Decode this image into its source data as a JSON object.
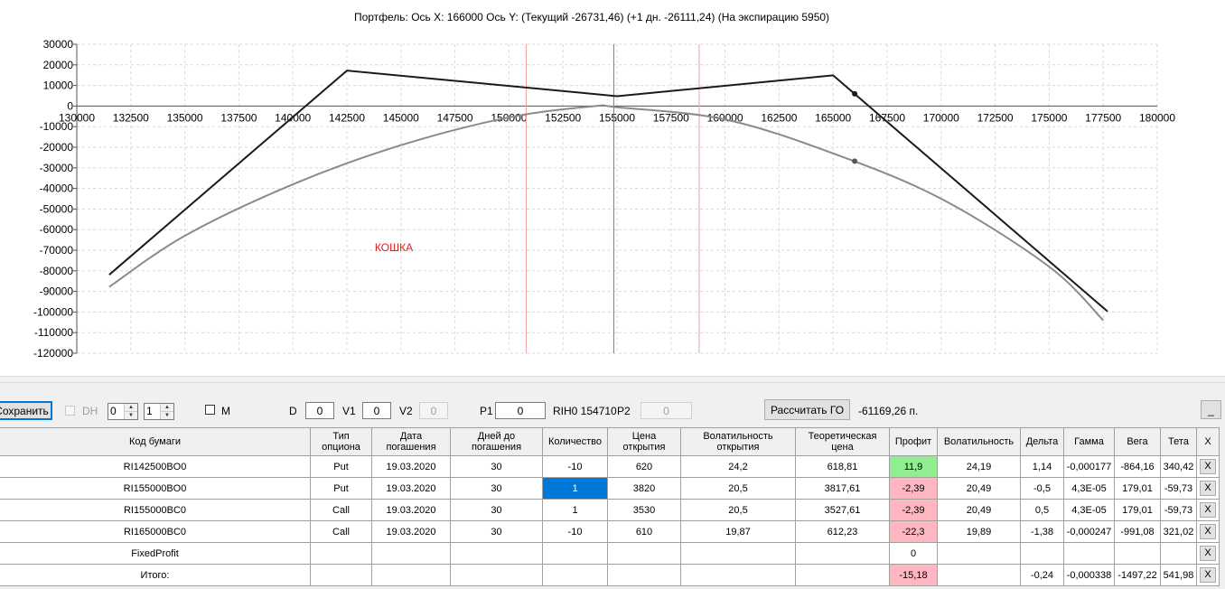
{
  "chart": {
    "title": "Портфель: Ось X: 166000 Ось Y:  (Текущий -26731,46)  (+1 дн. -26111,24)  (На экспирацию 5950)",
    "annotation": "КОШКА"
  },
  "chart_data": {
    "type": "line",
    "title": "Портфель: Ось X: 166000 Ось Y:  (Текущий -26731,46)  (+1 дн. -26111,24)  (На экспирацию 5950)",
    "xlim": [
      130000,
      180000
    ],
    "ylim": [
      -120000,
      30000
    ],
    "x_ticks": [
      "130000",
      "132500",
      "135000",
      "137500",
      "140000",
      "142500",
      "145000",
      "147500",
      "150000",
      "152500",
      "155000",
      "157500",
      "160000",
      "162500",
      "165000",
      "167500",
      "170000",
      "172500",
      "175000",
      "177500",
      "180000"
    ],
    "y_ticks": [
      "30000",
      "20000",
      "10000",
      "0",
      "-10000",
      "-20000",
      "-30000",
      "-40000",
      "-50000",
      "-60000",
      "-70000",
      "-80000",
      "-90000",
      "-100000",
      "-110000",
      "-120000"
    ],
    "grid": true,
    "colors": {
      "expiration": "#1a1a1a",
      "current": "#8a8a8a",
      "vline_center": "#6a7f99",
      "vline_sigma": "#f2a0a0",
      "annotation": "#dd2020"
    },
    "series": [
      {
        "x": [
          131500,
          142500,
          155000,
          165000,
          177700
        ],
        "y": [
          -81900,
          17200,
          4800,
          14900,
          -99700
        ]
      },
      {
        "x": [
          131500,
          135000,
          140000,
          145000,
          150000,
          153900,
          155000,
          160000,
          165000,
          170000,
          175000,
          177500
        ],
        "y": [
          -87800,
          -63000,
          -38000,
          -19000,
          -5500,
          -100,
          -600,
          -6500,
          -23000,
          -45000,
          -78000,
          -104000
        ]
      }
    ],
    "markers": [
      {
        "x": 166000,
        "y": 5950
      },
      {
        "x": 166000,
        "y": -26731
      }
    ],
    "vertical_lines": [
      {
        "x": 150800,
        "kind": "sigma"
      },
      {
        "x": 154850,
        "kind": "center"
      },
      {
        "x": 158800,
        "kind": "sigma"
      }
    ],
    "annotations": [
      {
        "text": "КОШКА",
        "x": 141200,
        "y": -68000
      }
    ]
  },
  "toolbar": {
    "save_label": "Сохранить",
    "dh_label": "DH",
    "spin1_value": "0",
    "spin2_value": "1",
    "m_label": "M",
    "d_label": "D",
    "d_value": "0",
    "v1_label": "V1",
    "v1_value": "0",
    "v2_label": "V2",
    "v2_value": "0",
    "p1_label": "P1",
    "p1_value": "0",
    "ticker_text": "RIH0 154710",
    "p2_label": "P2",
    "p2_value": "0",
    "calc_label": "Рассчитать ГО",
    "go_value": "-61169,26 п.",
    "minimize_label": "_"
  },
  "table": {
    "headers": [
      "Код бумаги",
      "Тип опциона",
      "Дата погашения",
      "Дней до погашения",
      "Количество",
      "Цена открытия",
      "Волатильность открытия",
      "Теоретическая цена",
      "Профит",
      "Волатильность",
      "Дельта",
      "Гамма",
      "Вега",
      "Тета",
      "X"
    ],
    "rows": [
      {
        "cells": [
          "RI142500BO0",
          "Put",
          "19.03.2020",
          "30",
          "-10",
          "620",
          "24,2",
          "618,81",
          "11,9",
          "24,19",
          "1,14",
          "-0,000177",
          "-864,16",
          "340,42"
        ],
        "delete": "X"
      },
      {
        "cells": [
          "RI155000BO0",
          "Put",
          "19.03.2020",
          "30",
          "1",
          "3820",
          "20,5",
          "3817,61",
          "-2,39",
          "20,49",
          "-0,5",
          "4,3E-05",
          "179,01",
          "-59,73"
        ],
        "delete": "X"
      },
      {
        "cells": [
          "RI155000BC0",
          "Call",
          "19.03.2020",
          "30",
          "1",
          "3530",
          "20,5",
          "3527,61",
          "-2,39",
          "20,49",
          "0,5",
          "4,3E-05",
          "179,01",
          "-59,73"
        ],
        "delete": "X"
      },
      {
        "cells": [
          "RI165000BC0",
          "Call",
          "19.03.2020",
          "30",
          "-10",
          "610",
          "19,87",
          "612,23",
          "-22,3",
          "19,89",
          "-1,38",
          "-0,000247",
          "-991,08",
          "321,02"
        ],
        "delete": "X"
      },
      {
        "cells": [
          "FixedProfit",
          "",
          "",
          "",
          "",
          "",
          "",
          "",
          "0",
          "",
          "",
          "",
          "",
          ""
        ],
        "delete": "X"
      },
      {
        "cells": [
          "Итого:",
          "",
          "",
          "",
          "",
          "",
          "",
          "",
          "-15,18",
          "",
          "-0,24",
          "-0,000338",
          "-1497,22",
          "541,98"
        ],
        "delete": "X"
      }
    ]
  }
}
